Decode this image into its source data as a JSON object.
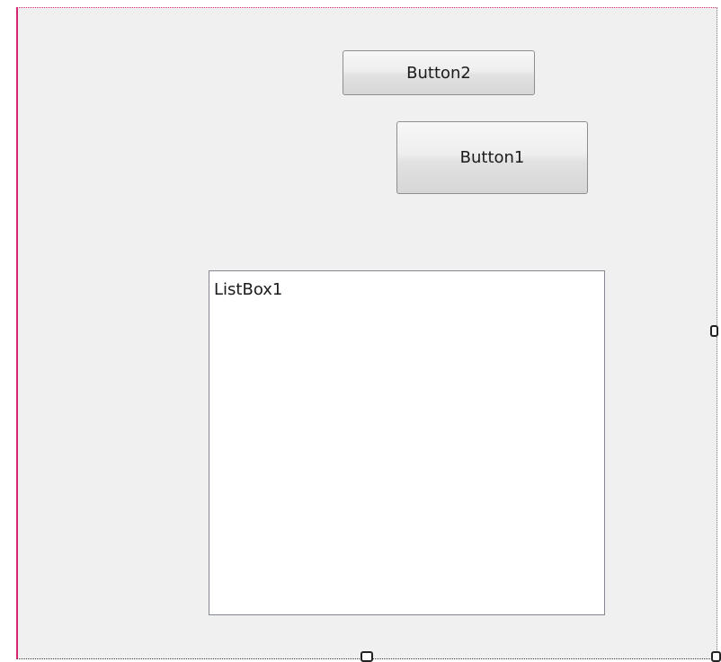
{
  "form": {
    "buttons": [
      {
        "label": "Button2"
      },
      {
        "label": "Button1"
      }
    ],
    "listbox": {
      "label": "ListBox1"
    }
  },
  "colors": {
    "form_background": "#f0f0f0",
    "selection_border": "#d6246e",
    "listbox_background": "#ffffff"
  }
}
